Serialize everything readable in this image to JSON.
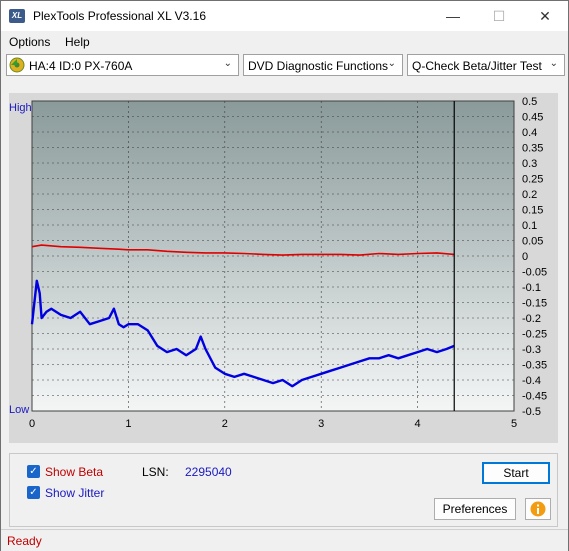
{
  "window": {
    "title": "PlexTools Professional XL V3.16",
    "icon_text": "XL"
  },
  "menu": [
    {
      "label": "Options"
    },
    {
      "label": "Help"
    }
  ],
  "combos": {
    "drive": "HA:4 ID:0  PX-760A",
    "function": "DVD Diagnostic Functions",
    "test": "Q-Check Beta/Jitter Test"
  },
  "chart_data": {
    "type": "line",
    "left_axis": {
      "top_label": "High",
      "bottom_label": "Low"
    },
    "x_ticks": [
      "0",
      "1",
      "2",
      "3",
      "4",
      "5"
    ],
    "y_ticks": [
      "0.5",
      "0.45",
      "0.4",
      "0.35",
      "0.3",
      "0.25",
      "0.2",
      "0.15",
      "0.1",
      "0.05",
      "0",
      "-0.05",
      "-0.1",
      "-0.15",
      "-0.2",
      "-0.25",
      "-0.3",
      "-0.35",
      "-0.4",
      "-0.45",
      "-0.5"
    ],
    "xlim": [
      0,
      5
    ],
    "ylim": [
      -0.5,
      0.5
    ],
    "marker_x": 4.38,
    "series": [
      {
        "color": "#e00000",
        "x": [
          0,
          0.1,
          0.3,
          0.5,
          0.7,
          0.9,
          1.0,
          1.2,
          1.4,
          1.6,
          1.8,
          2.0,
          2.2,
          2.4,
          2.6,
          2.8,
          3.0,
          3.2,
          3.4,
          3.6,
          3.8,
          4.0,
          4.2,
          4.38
        ],
        "y": [
          0.03,
          0.035,
          0.03,
          0.028,
          0.025,
          0.022,
          0.02,
          0.02,
          0.015,
          0.012,
          0.01,
          0.01,
          0.008,
          0.005,
          0.003,
          0.005,
          0.005,
          0.005,
          0.003,
          0.008,
          0.005,
          0.008,
          0.01,
          0.005
        ]
      },
      {
        "color": "#0000e0",
        "x": [
          0,
          0.05,
          0.08,
          0.1,
          0.15,
          0.2,
          0.3,
          0.4,
          0.5,
          0.6,
          0.7,
          0.8,
          0.85,
          0.9,
          0.95,
          1.0,
          1.1,
          1.2,
          1.3,
          1.4,
          1.5,
          1.6,
          1.7,
          1.75,
          1.8,
          1.9,
          2.0,
          2.1,
          2.2,
          2.3,
          2.4,
          2.5,
          2.6,
          2.7,
          2.8,
          2.9,
          3.0,
          3.1,
          3.2,
          3.3,
          3.4,
          3.5,
          3.6,
          3.7,
          3.8,
          3.9,
          4.0,
          4.1,
          4.2,
          4.3,
          4.38
        ],
        "y": [
          -0.22,
          -0.08,
          -0.12,
          -0.2,
          -0.18,
          -0.17,
          -0.19,
          -0.2,
          -0.18,
          -0.22,
          -0.21,
          -0.2,
          -0.17,
          -0.22,
          -0.23,
          -0.22,
          -0.22,
          -0.24,
          -0.29,
          -0.31,
          -0.3,
          -0.32,
          -0.3,
          -0.26,
          -0.3,
          -0.36,
          -0.38,
          -0.39,
          -0.38,
          -0.39,
          -0.4,
          -0.41,
          -0.4,
          -0.42,
          -0.4,
          -0.39,
          -0.38,
          -0.37,
          -0.36,
          -0.35,
          -0.34,
          -0.33,
          -0.33,
          -0.32,
          -0.33,
          -0.32,
          -0.31,
          -0.3,
          -0.31,
          -0.3,
          -0.29
        ]
      }
    ]
  },
  "options": {
    "show_beta": {
      "label": "Show Beta",
      "checked": true
    },
    "show_jitter": {
      "label": "Show Jitter",
      "checked": true
    },
    "lsn_label": "LSN:",
    "lsn_value": "2295040"
  },
  "buttons": {
    "start": "Start",
    "preferences": "Preferences"
  },
  "status": "Ready"
}
